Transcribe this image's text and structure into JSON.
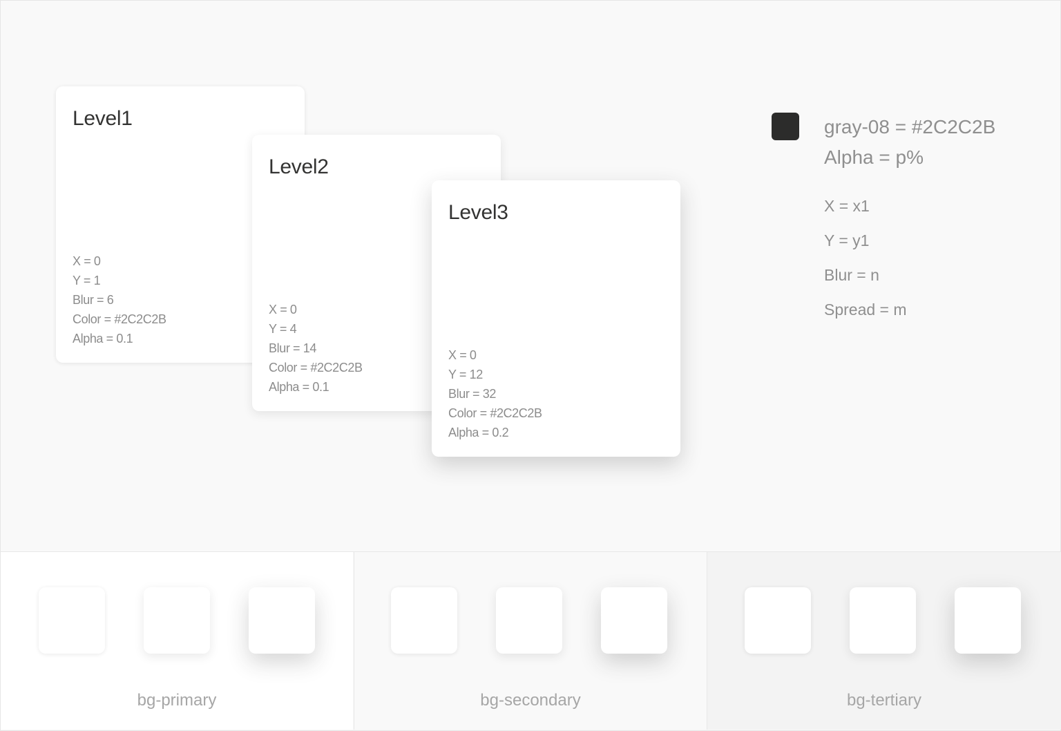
{
  "levels": [
    {
      "title": "Level1",
      "specs": [
        "X = 0",
        "Y = 1",
        "Blur = 6",
        "Color = #2C2C2B",
        "Alpha = 0.1"
      ]
    },
    {
      "title": "Level2",
      "specs": [
        "X = 0",
        "Y = 4",
        "Blur = 14",
        "Color = #2C2C2B",
        "Alpha = 0.1"
      ]
    },
    {
      "title": "Level3",
      "specs": [
        "X = 0",
        "Y = 12",
        "Blur = 32",
        "Color = #2C2C2B",
        "Alpha = 0.2"
      ]
    }
  ],
  "legend": {
    "swatch_color": "#2C2C2B",
    "color_line": "gray-08 = #2C2C2B",
    "alpha_line": "Alpha = p%",
    "params": [
      "X = x1",
      "Y = y1",
      "Blur = n",
      "Spread = m"
    ]
  },
  "backgrounds": [
    {
      "label": "bg-primary",
      "color": "#FFFFFF"
    },
    {
      "label": "bg-secondary",
      "color": "#F9F9F9"
    },
    {
      "label": "bg-tertiary",
      "color": "#F3F3F3"
    }
  ]
}
